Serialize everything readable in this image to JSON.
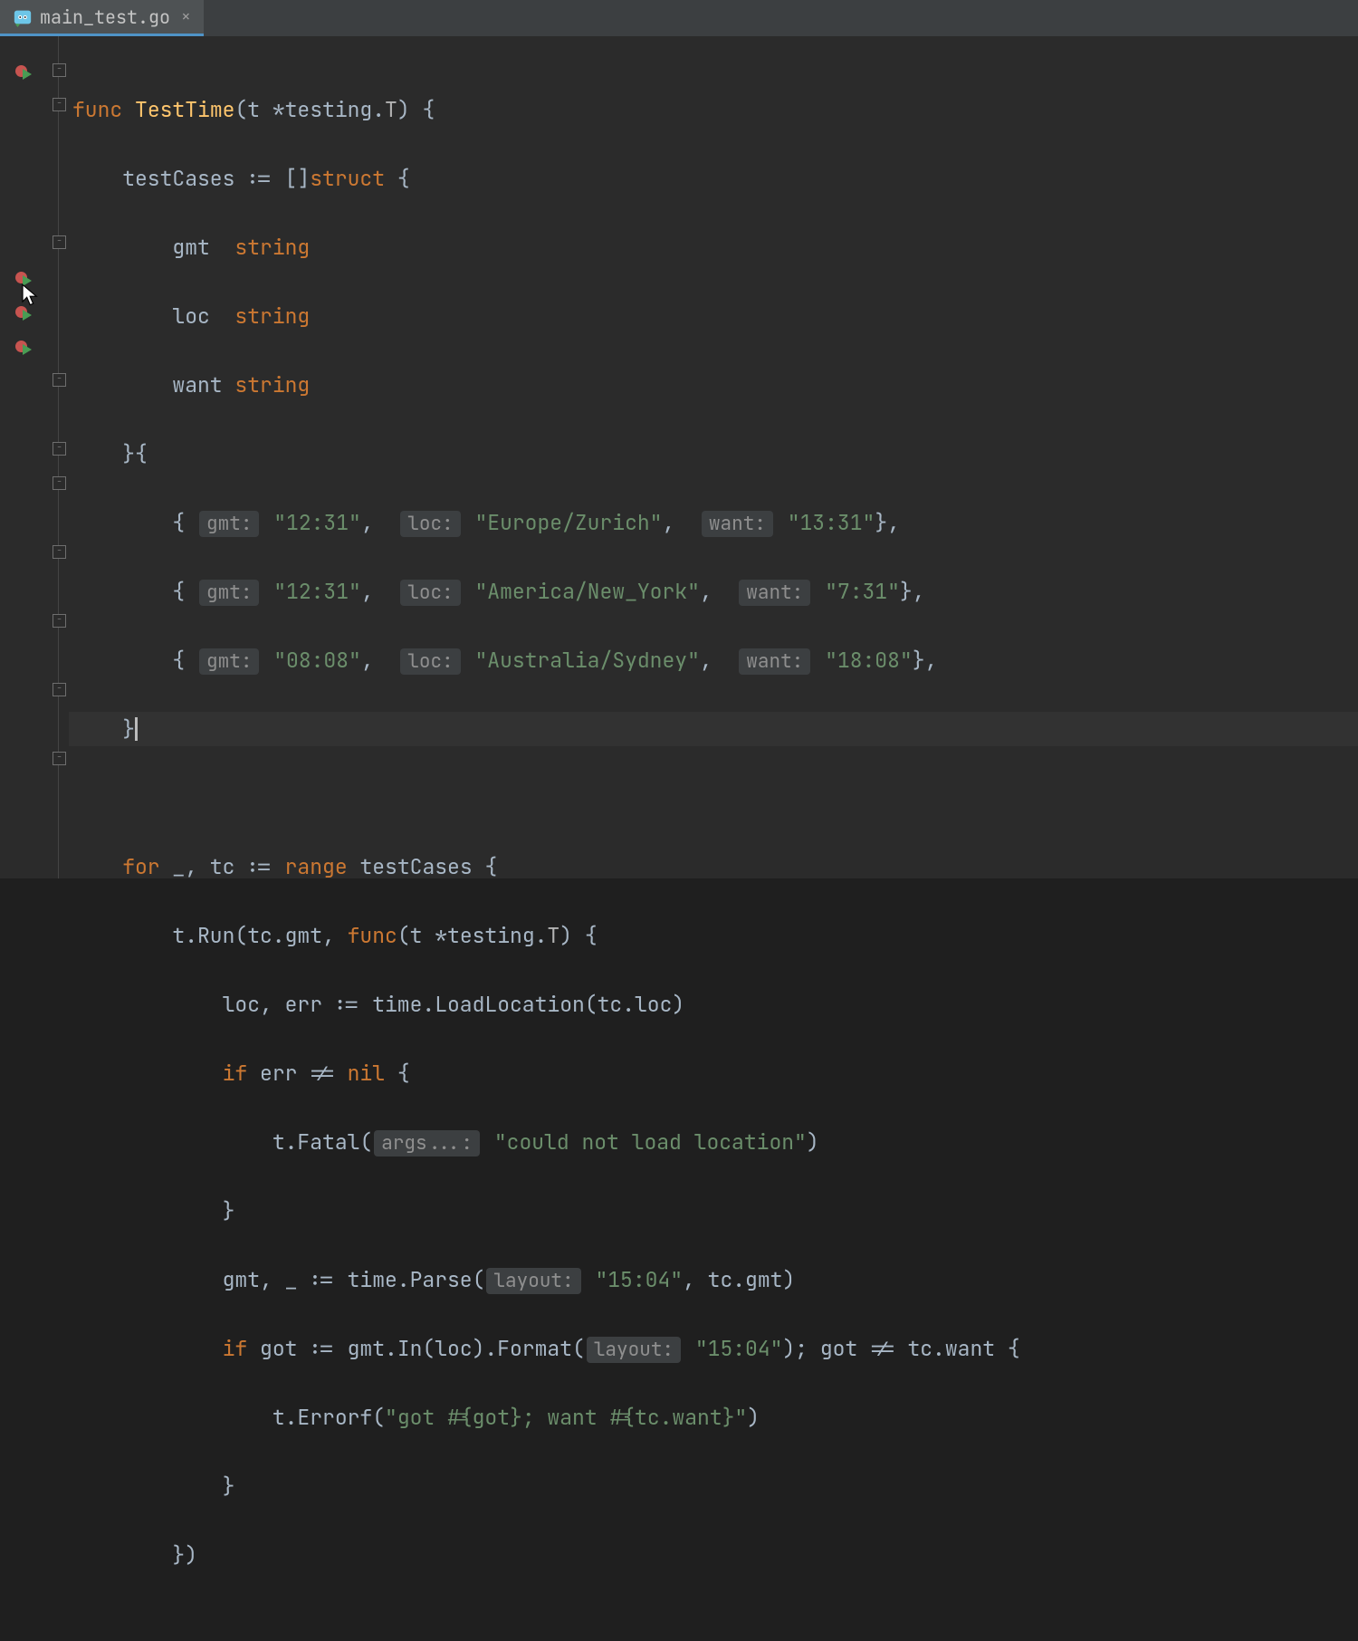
{
  "tab": {
    "filename": "main_test.go",
    "close_glyph": "×"
  },
  "code": {
    "l1": {
      "func": "func",
      "name": "TestTime",
      "sig_open": "(t *testing.",
      "T": "T",
      "sig_close": ") {"
    },
    "l2": {
      "txt": "testCases := []",
      "struct": "struct",
      "brace": " {"
    },
    "l3": {
      "name": "gmt",
      "type": "string"
    },
    "l4": {
      "name": "loc",
      "type": "string"
    },
    "l5": {
      "name": "want",
      "type": "string"
    },
    "l6": {
      "txt": "}{"
    },
    "rows": [
      {
        "gmt": "\"12:31\"",
        "loc": "\"Europe/Zurich\"",
        "want": "\"13:31\""
      },
      {
        "gmt": "\"12:31\"",
        "loc": "\"America/New_York\"",
        "want": "\"7:31\""
      },
      {
        "gmt": "\"08:08\"",
        "loc": "\"Australia/Sydney\"",
        "want": "\"18:08\""
      }
    ],
    "hints": {
      "gmt": "gmt:",
      "loc": "loc:",
      "want": "want:",
      "args": "args...:",
      "layout": "layout:"
    },
    "l10_close": "}",
    "l12": {
      "for": "for",
      "rest": " _, tc := ",
      "range": "range",
      "tail": " testCases {"
    },
    "l13": {
      "pre": "t.Run(tc.gmt, ",
      "func": "func",
      "mid": "(t *testing.",
      "T": "T",
      "tail": ") {"
    },
    "l14": "loc, err := time.LoadLocation(tc.loc)",
    "l15": {
      "if": "if",
      "mid": " err != ",
      "nil": "nil",
      "brace": " {"
    },
    "l16": {
      "pre": "t.Fatal(",
      "str": "\"could not load location\"",
      "tail": ")"
    },
    "l17": "}",
    "l18": {
      "pre": "gmt, _ := time.Parse(",
      "str": "\"15:04\"",
      "tail": ", tc.gmt)"
    },
    "l19": {
      "if": "if",
      "pre": " got := gmt.In(loc).Format(",
      "str": "\"15:04\"",
      "tail": "); got != tc.want {"
    },
    "l20": {
      "pre": "t.Errorf(",
      "str": "\"got #{got}; want #{tc.want}\"",
      "tail": ")"
    },
    "l21": "}",
    "l22": "})"
  }
}
